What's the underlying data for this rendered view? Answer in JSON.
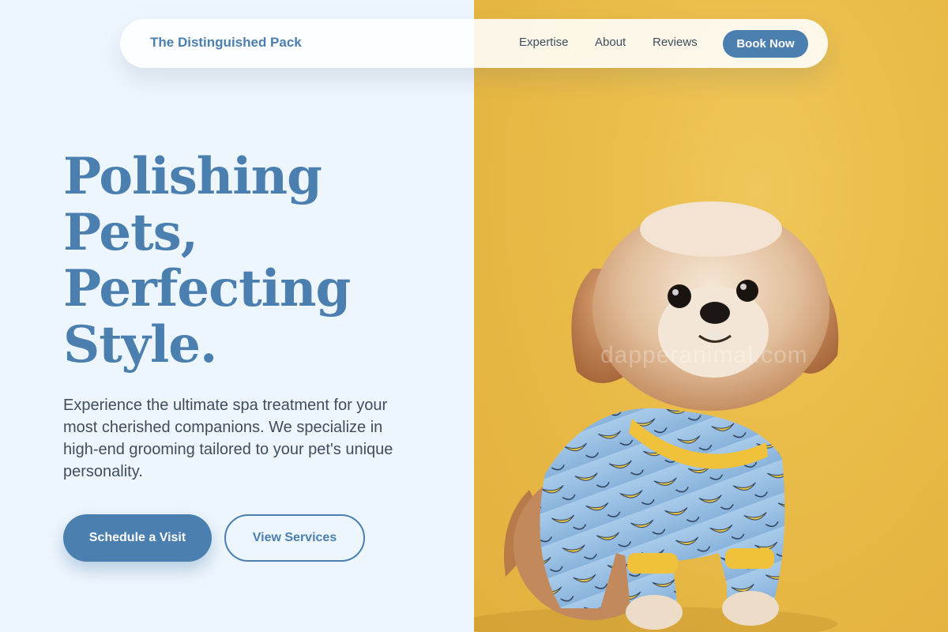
{
  "nav": {
    "brand": "The Distinguished Pack",
    "links": [
      "Expertise",
      "About",
      "Reviews"
    ],
    "cta": "Book Now"
  },
  "hero": {
    "title_lines": [
      "Polishing",
      "Pets,",
      "Perfecting",
      "Style."
    ],
    "description": "Experience the ultimate spa treatment for your most cherished companions. We specialize in high-end grooming tailored to your pet's unique personality.",
    "primary_button": "Schedule a Visit",
    "secondary_button": "View Services"
  },
  "image": {
    "subject": "dog-in-banana-print-pajamas",
    "watermark": "dapperanimal.com"
  },
  "colors": {
    "accent": "#4a7fb0",
    "background": "#eef6fd",
    "body_text": "#3f4d5c",
    "photo_background": "#e9bb48"
  }
}
